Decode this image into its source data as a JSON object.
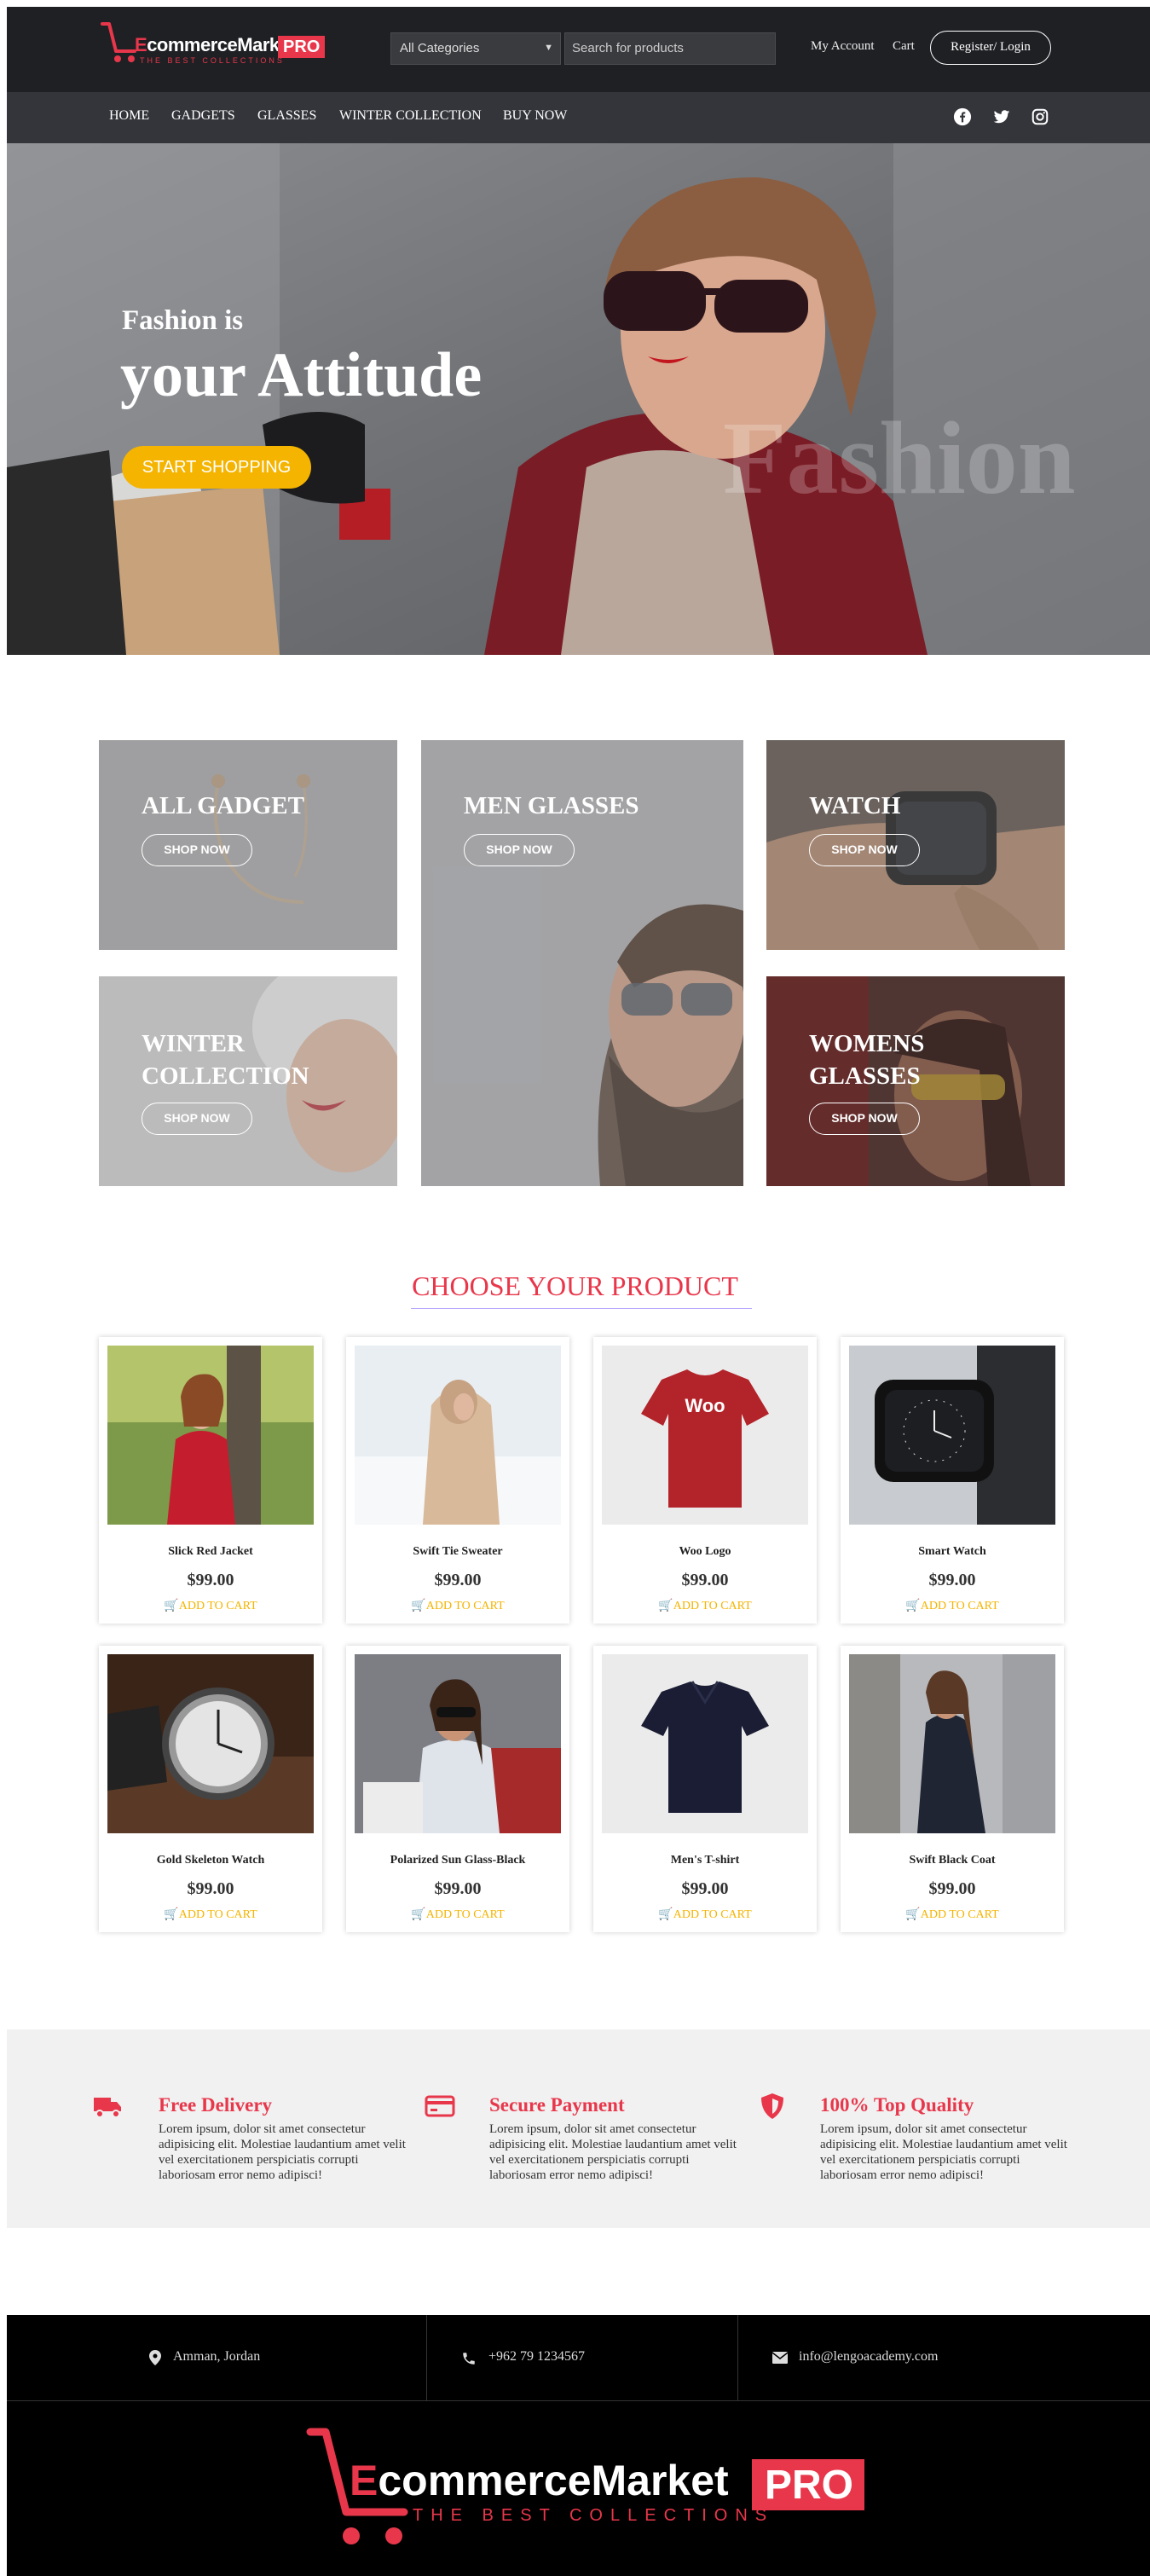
{
  "header": {
    "brand_name": "commerceMarket",
    "brand_initial": "E",
    "brand_pro": "PRO",
    "brand_tagline": "THE BEST COLLECTIONS",
    "category_select": "All Categories",
    "search_placeholder": "Search for products",
    "my_account": "My Account",
    "cart": "Cart",
    "register_login": "Register/ Login"
  },
  "nav": {
    "items": [
      "HOME",
      "GADGETS",
      "GLASSES",
      "WINTER COLLECTION",
      "BUY NOW"
    ],
    "social_icons": [
      "facebook-icon",
      "twitter-icon",
      "instagram-icon"
    ]
  },
  "hero": {
    "subtitle": "Fashion is",
    "title": "your Attitude",
    "button": "START SHOPPING",
    "watermark": "Fashion"
  },
  "categories": [
    {
      "title": "ALL GADGET",
      "button": "SHOP NOW"
    },
    {
      "title": "MEN GLASSES",
      "button": "SHOP NOW"
    },
    {
      "title": "WATCH",
      "button": "SHOP NOW"
    },
    {
      "title": "WINTER COLLECTION",
      "title_line1": "WINTER",
      "title_line2": "COLLECTION",
      "button": "SHOP NOW"
    },
    {
      "title": "WOMENS GLASSES",
      "title_line1": "WOMENS",
      "title_line2": "GLASSES",
      "button": "SHOP NOW"
    }
  ],
  "products_section": {
    "title": "CHOOSE YOUR PRODUCT",
    "add_to_cart": "ADD TO CART",
    "items": [
      {
        "name": "Slick Red Jacket",
        "price": "$99.00"
      },
      {
        "name": "Swift Tie Sweater",
        "price": "$99.00"
      },
      {
        "name": "Woo Logo",
        "price": "$99.00",
        "print": "Woo"
      },
      {
        "name": "Smart Watch",
        "price": "$99.00"
      },
      {
        "name": "Gold Skeleton Watch",
        "price": "$99.00"
      },
      {
        "name": "Polarized Sun Glass-Black",
        "price": "$99.00"
      },
      {
        "name": "Men's T-shirt",
        "price": "$99.00"
      },
      {
        "name": "Swift Black Coat",
        "price": "$99.00"
      }
    ]
  },
  "features": [
    {
      "icon": "truck-icon",
      "title": "Free Delivery",
      "text": "Lorem ipsum, dolor sit amet consectetur adipisicing elit. Molestiae laudantium amet velit vel exercitationem perspiciatis corrupti laboriosam error nemo adipisci!"
    },
    {
      "icon": "credit-card-icon",
      "title": "Secure Payment",
      "text": "Lorem ipsum, dolor sit amet consectetur adipisicing elit. Molestiae laudantium amet velit vel exercitationem perspiciatis corrupti laboriosam error nemo adipisci!"
    },
    {
      "icon": "shield-icon",
      "title": "100% Top Quality",
      "text": "Lorem ipsum, dolor sit amet consectetur adipisicing elit. Molestiae laudantium amet velit vel exercitationem perspiciatis corrupti laboriosam error nemo adipisci!"
    }
  ],
  "footer": {
    "address": "Amman, Jordan",
    "phone": "+962 79 1234567",
    "email": "info@lengoacademy.com"
  },
  "colors": {
    "accent": "#e8374b",
    "button_yellow": "#f4b400",
    "topbar": "#1f2024",
    "navbar": "#33353a"
  }
}
